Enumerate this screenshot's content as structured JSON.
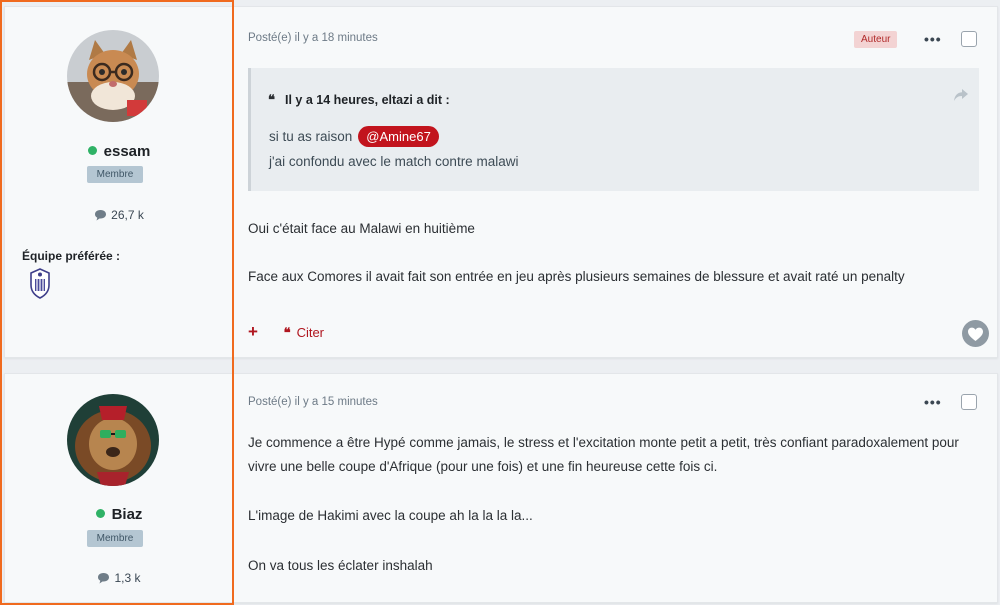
{
  "posts": [
    {
      "author": {
        "name": "essam",
        "role": "Membre",
        "count": "26,7 k",
        "favorite_label": "Équipe préférée :"
      },
      "meta": "Posté(e) il y a 18 minutes",
      "author_badge": "Auteur",
      "quote": {
        "header": "Il y a 14 heures, eltazi a dit :",
        "line1": "si tu as raison",
        "mention": "@Amine67",
        "line2": "j'ai confondu avec le match contre malawi"
      },
      "body": [
        "Oui c'était face au Malawi en huitième",
        "Face aux Comores il avait fait son entrée en jeu après plusieurs semaines de blessure et avait raté un penalty"
      ],
      "actions": {
        "add": "+",
        "quote_label": "Citer"
      }
    },
    {
      "author": {
        "name": "Biaz",
        "role": "Membre",
        "count": "1,3 k"
      },
      "meta": "Posté(e) il y a 15 minutes",
      "body": [
        "Je commence a être Hypé comme jamais, le stress et l'excitation monte petit a petit, très confiant paradoxalement pour vivre une belle coupe d'Afrique (pour une fois) et une fin heureuse cette fois ci.",
        "L'image de Hakimi avec la coupe ah la la la la...",
        "On va tous les éclater inshalah"
      ]
    }
  ],
  "colors": {
    "accent": "#c2141d",
    "online": "#2fb266",
    "highlight": "#f06a1e"
  }
}
